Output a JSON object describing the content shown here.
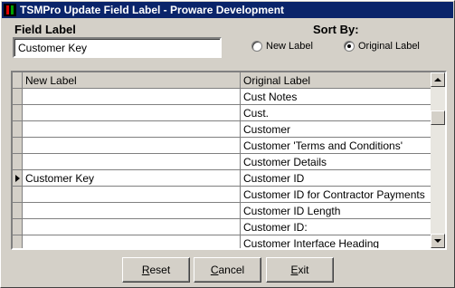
{
  "window": {
    "title": "TSMPro Update Field Label - Proware Development"
  },
  "field_label": {
    "label": "Field Label",
    "value": "Customer Key"
  },
  "sort_by": {
    "label": "Sort By:",
    "options": [
      {
        "label": "New Label",
        "selected": false
      },
      {
        "label": "Original Label",
        "selected": true
      }
    ]
  },
  "grid": {
    "headers": {
      "new_label": "New Label",
      "original_label": "Original Label"
    },
    "rows": [
      {
        "new_label": "",
        "original_label": "Cust Notes",
        "current": false
      },
      {
        "new_label": "",
        "original_label": "Cust.",
        "current": false
      },
      {
        "new_label": "",
        "original_label": "Customer",
        "current": false
      },
      {
        "new_label": "",
        "original_label": "Customer 'Terms and Conditions'",
        "current": false
      },
      {
        "new_label": "",
        "original_label": "Customer Details",
        "current": false
      },
      {
        "new_label": "Customer Key",
        "original_label": "Customer ID",
        "current": true
      },
      {
        "new_label": "",
        "original_label": "Customer ID for Contractor Payments",
        "current": false
      },
      {
        "new_label": "",
        "original_label": "Customer ID Length",
        "current": false
      },
      {
        "new_label": "",
        "original_label": "Customer ID:",
        "current": false
      },
      {
        "new_label": "",
        "original_label": "Customer Interface Heading",
        "current": false
      }
    ]
  },
  "buttons": {
    "reset": {
      "mnemonic": "R",
      "rest": "eset"
    },
    "cancel": {
      "mnemonic": "C",
      "rest": "ancel"
    },
    "exit": {
      "mnemonic": "E",
      "rest": "xit"
    }
  },
  "colors": {
    "titlebar": "#0a246a",
    "face": "#d4d0c8"
  }
}
